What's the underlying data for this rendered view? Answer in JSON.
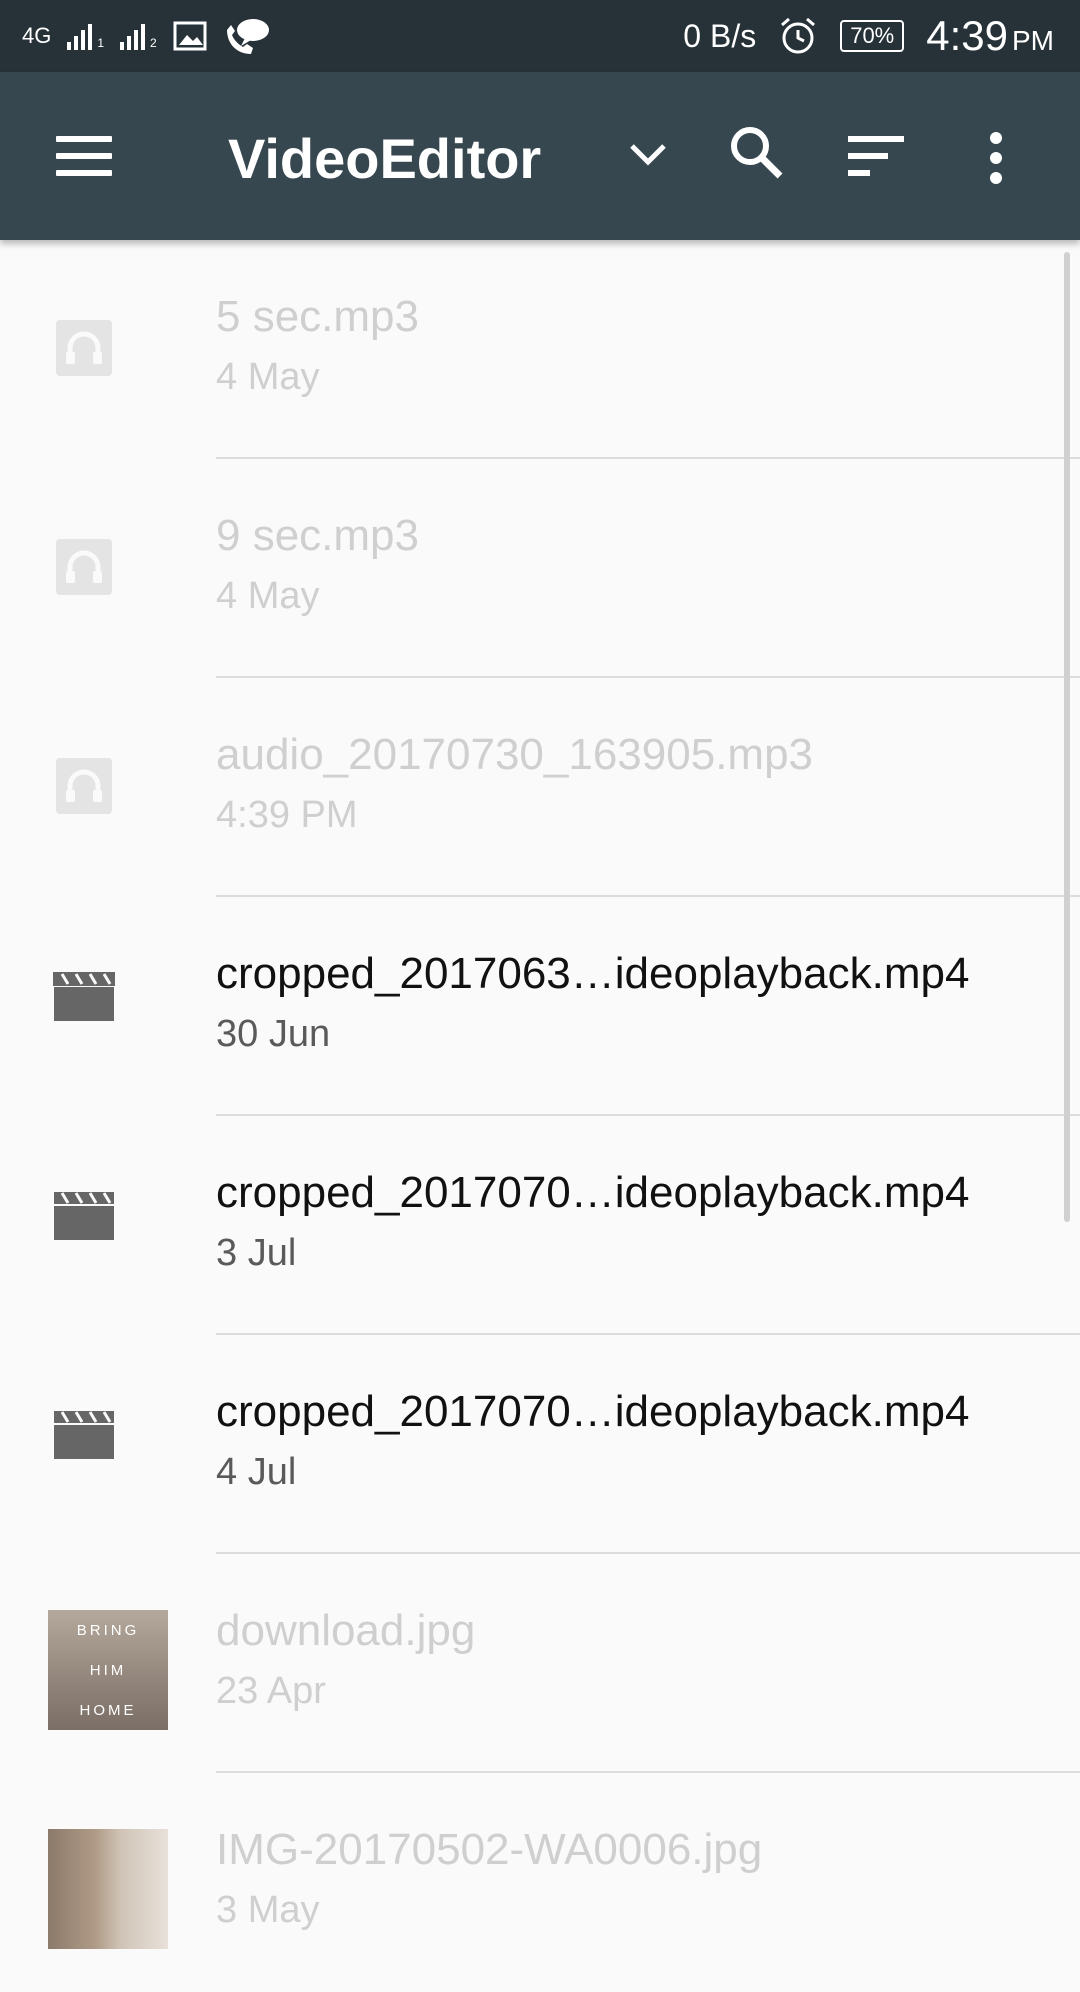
{
  "status_bar": {
    "network": "4G",
    "sim1": "1",
    "sim2": "2",
    "speed": "0 B/s",
    "battery": "70%",
    "time": "4:39",
    "ampm": "PM"
  },
  "app_bar": {
    "title": "VideoEditor"
  },
  "files": [
    {
      "name": "5 sec.mp3",
      "date": "4 May",
      "type": "audio"
    },
    {
      "name": "9 sec.mp3",
      "date": "4 May",
      "type": "audio"
    },
    {
      "name": "audio_20170730_163905.mp3",
      "date": "4:39 PM",
      "type": "audio"
    },
    {
      "name": "cropped_2017063…ideoplayback.mp4",
      "date": "30 Jun",
      "type": "video"
    },
    {
      "name": "cropped_2017070…ideoplayback.mp4",
      "date": "3 Jul",
      "type": "video"
    },
    {
      "name": "cropped_2017070…ideoplayback.mp4",
      "date": "4 Jul",
      "type": "video"
    },
    {
      "name": "download.jpg",
      "date": "23 Apr",
      "type": "image",
      "thumb_text": [
        "BRING",
        "HIM",
        "HOME"
      ]
    },
    {
      "name": "IMG-20170502-WA0006.jpg",
      "date": "3 May",
      "type": "image"
    }
  ],
  "colors": {
    "status_bar_bg": "#263238",
    "app_bar_bg": "#37474f",
    "active_text": "#111111",
    "dim_text": "#cfcfcf"
  }
}
